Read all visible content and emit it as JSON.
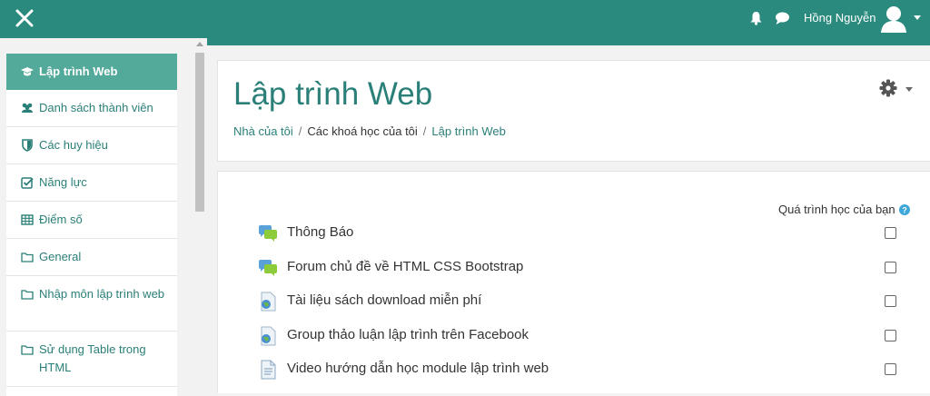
{
  "topbar": {
    "user_name": "Hồng Nguyễn",
    "accent_color": "#2a8a7e",
    "icons": [
      "close-icon",
      "bell-icon",
      "chat-icon",
      "user-avatar-icon",
      "caret-down-icon"
    ]
  },
  "sidebar": {
    "items": [
      {
        "label": "Lập trình Web",
        "icon": "graduation-cap-icon",
        "active": true
      },
      {
        "label": "Danh sách thành viên",
        "icon": "users-icon"
      },
      {
        "label": "Các huy hiệu",
        "icon": "shield-icon"
      },
      {
        "label": "Năng lực",
        "icon": "checkbox-icon"
      },
      {
        "label": "Điểm số",
        "icon": "table-icon"
      },
      {
        "label": "General",
        "icon": "folder-icon"
      },
      {
        "label": "Nhập môn lập trình web",
        "icon": "folder-icon"
      },
      {
        "label": "Sử dụng Table trong HTML",
        "icon": "folder-icon"
      }
    ]
  },
  "header": {
    "title": "Lập trình Web",
    "breadcrumb": [
      "Nhà của tôi",
      "Các khoá học của tôi",
      "Lập trình Web"
    ]
  },
  "content": {
    "progress_label": "Quá trình học của bạn",
    "activities": [
      {
        "name": "Thông Báo",
        "icon": "forum-icon"
      },
      {
        "name": "Forum chủ đề về HTML CSS Bootstrap",
        "icon": "forum-icon"
      },
      {
        "name": "Tài liệu sách download miễn phí",
        "icon": "url-icon"
      },
      {
        "name": "Group thảo luận lập trình trên Facebook",
        "icon": "url-icon"
      },
      {
        "name": "Video hướng dẫn học module lập trình web",
        "icon": "page-icon"
      }
    ]
  }
}
